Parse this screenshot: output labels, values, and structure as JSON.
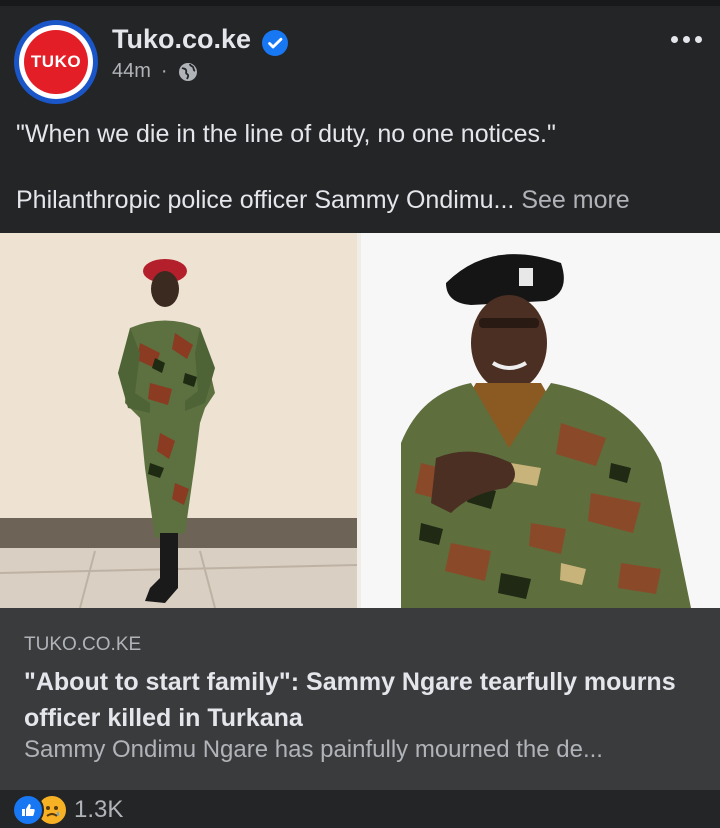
{
  "post": {
    "page_name": "Tuko.co.ke",
    "avatar_text": "TUKO",
    "timestamp": "44m",
    "separator": "·",
    "audience_icon": "globe-icon",
    "quote_line": "\"When we die in the line of duty, no one notices.\"",
    "snippet": "Philanthropic police officer Sammy Ondimu...",
    "see_more_label": "See more"
  },
  "link_preview": {
    "domain": "TUKO.CO.KE",
    "title": "\"About to start family\": Sammy Ngare tearfully mourns officer killed in Turkana",
    "description": "Sammy Ondimu Ngare has painfully mourned the de..."
  },
  "reactions": {
    "icons": [
      "like-icon",
      "sad-icon"
    ],
    "count": "1.3K"
  },
  "colors": {
    "background": "#242526",
    "card": "#3a3b3c",
    "accent": "#1877f2",
    "brand_red": "#e41e26"
  }
}
